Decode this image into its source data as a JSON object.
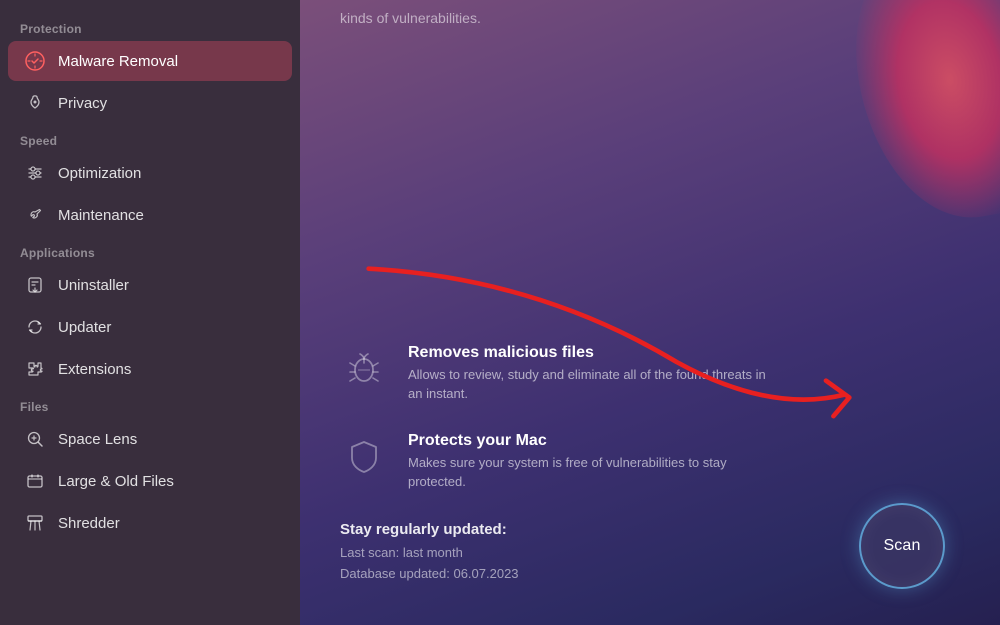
{
  "sidebar": {
    "sections": [
      {
        "label": "Protection",
        "items": [
          {
            "id": "malware-removal",
            "label": "Malware Removal",
            "icon": "🛡️",
            "active": true
          },
          {
            "id": "privacy",
            "label": "Privacy",
            "icon": "✋",
            "active": false
          }
        ]
      },
      {
        "label": "Speed",
        "items": [
          {
            "id": "optimization",
            "label": "Optimization",
            "icon": "⚙️",
            "active": false
          },
          {
            "id": "maintenance",
            "label": "Maintenance",
            "icon": "🔧",
            "active": false
          }
        ]
      },
      {
        "label": "Applications",
        "items": [
          {
            "id": "uninstaller",
            "label": "Uninstaller",
            "icon": "⬇️",
            "active": false
          },
          {
            "id": "updater",
            "label": "Updater",
            "icon": "🔄",
            "active": false
          },
          {
            "id": "extensions",
            "label": "Extensions",
            "icon": "🔀",
            "active": false
          }
        ]
      },
      {
        "label": "Files",
        "items": [
          {
            "id": "space-lens",
            "label": "Space Lens",
            "icon": "◎",
            "active": false
          },
          {
            "id": "large-old-files",
            "label": "Large & Old Files",
            "icon": "🗂️",
            "active": false
          },
          {
            "id": "shredder",
            "label": "Shredder",
            "icon": "📊",
            "active": false
          }
        ]
      }
    ]
  },
  "main": {
    "top_text": "kinds of vulnerabilities.",
    "features": [
      {
        "id": "removes-malicious",
        "title": "Removes malicious files",
        "description": "Allows to review, study and eliminate all of the found threats in an instant."
      },
      {
        "id": "protects-mac",
        "title": "Protects your Mac",
        "description": "Makes sure your system is free of vulnerabilities to stay protected."
      }
    ],
    "update": {
      "title": "Stay regularly updated:",
      "last_scan": "Last scan: last month",
      "database_updated": "Database updated: 06.07.2023"
    },
    "scan_button": {
      "label": "Scan"
    }
  }
}
